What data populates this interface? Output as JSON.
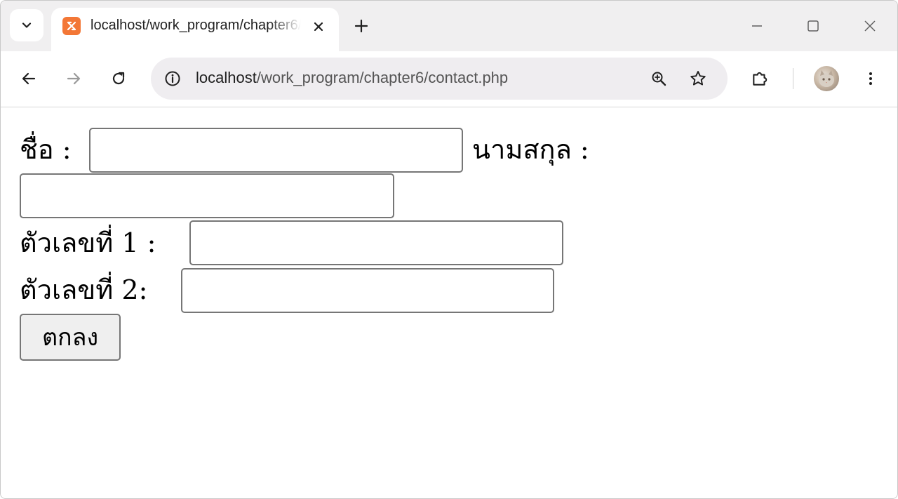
{
  "browser": {
    "tab": {
      "title": "localhost/work_program/chapter6/contact.php",
      "favicon": "xampp-icon"
    },
    "address_bar": {
      "host": "localhost",
      "path": "/work_program/chapter6/contact.php"
    },
    "icons": {
      "tab_search": "chevron-down-icon",
      "tab_close": "close-icon",
      "new_tab": "plus-icon",
      "minimize": "minimize-icon",
      "maximize": "maximize-icon",
      "close_window": "close-window-icon",
      "back": "back-arrow-icon",
      "forward": "forward-arrow-icon",
      "reload": "reload-icon",
      "site_info": "info-icon",
      "zoom": "zoom-icon",
      "bookmark": "star-icon",
      "extensions": "puzzle-icon",
      "profile": "avatar",
      "menu": "kebab-menu-icon"
    }
  },
  "form": {
    "first_name_label": "ชื่อ :",
    "first_name_value": "",
    "last_name_label": "นามสกุล :",
    "last_name_value": "",
    "number1_label": "ตัวเลขที่ 1 :",
    "number1_value": "",
    "number2_label": "ตัวเลขที่ 2:",
    "number2_value": "",
    "submit_label": "ตกลง"
  },
  "colors": {
    "tab_strip": "#f0eff0",
    "omnibox": "#efedf0",
    "favicon": "#f37736",
    "input_border": "#767676",
    "button_bg": "#efefef"
  }
}
